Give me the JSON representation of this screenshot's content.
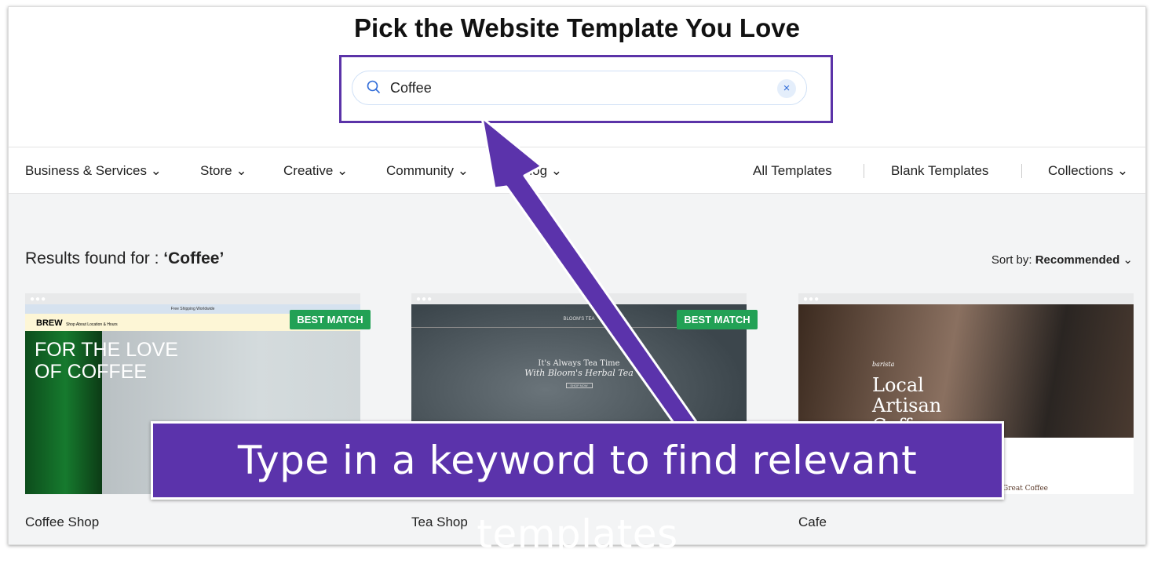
{
  "header": {
    "title": "Pick the Website Template You Love"
  },
  "search": {
    "value": "Coffee",
    "clear_icon": "close-icon",
    "search_icon": "search-icon"
  },
  "nav": {
    "categories": [
      "Business & Services",
      "Store",
      "Creative",
      "Community",
      "Blog"
    ],
    "links": [
      "All Templates",
      "Blank Templates",
      "Collections"
    ]
  },
  "results": {
    "prefix": "Results found for : ",
    "query": "‘Coffee’",
    "sort_label": "Sort by:",
    "sort_value": "Recommended"
  },
  "templates": [
    {
      "name": "Coffee Shop",
      "badge": "BEST MATCH",
      "preview": {
        "topbar": "Free Shipping Worldwide",
        "logo": "BREW",
        "menu": "Shop   About   Location & Hours",
        "headline1": "FOR THE LOVE",
        "headline2": "OF COFFEE"
      }
    },
    {
      "name": "Tea Shop",
      "badge": "BEST MATCH",
      "preview": {
        "logo": "BLOOM'S TEA",
        "headline1": "It's Always Tea Time",
        "headline2": "With Bloom's Herbal Tea",
        "button": "SHOP NOW"
      }
    },
    {
      "name": "Cafe",
      "preview": {
        "script": "barista",
        "headline1": "Local",
        "headline2": "Artisan",
        "headline3": "Coffee",
        "footer": "Great Coffee"
      }
    }
  ],
  "annotation": {
    "text": "Type in a keyword to find relevant templates",
    "color": "#5b33ab"
  }
}
